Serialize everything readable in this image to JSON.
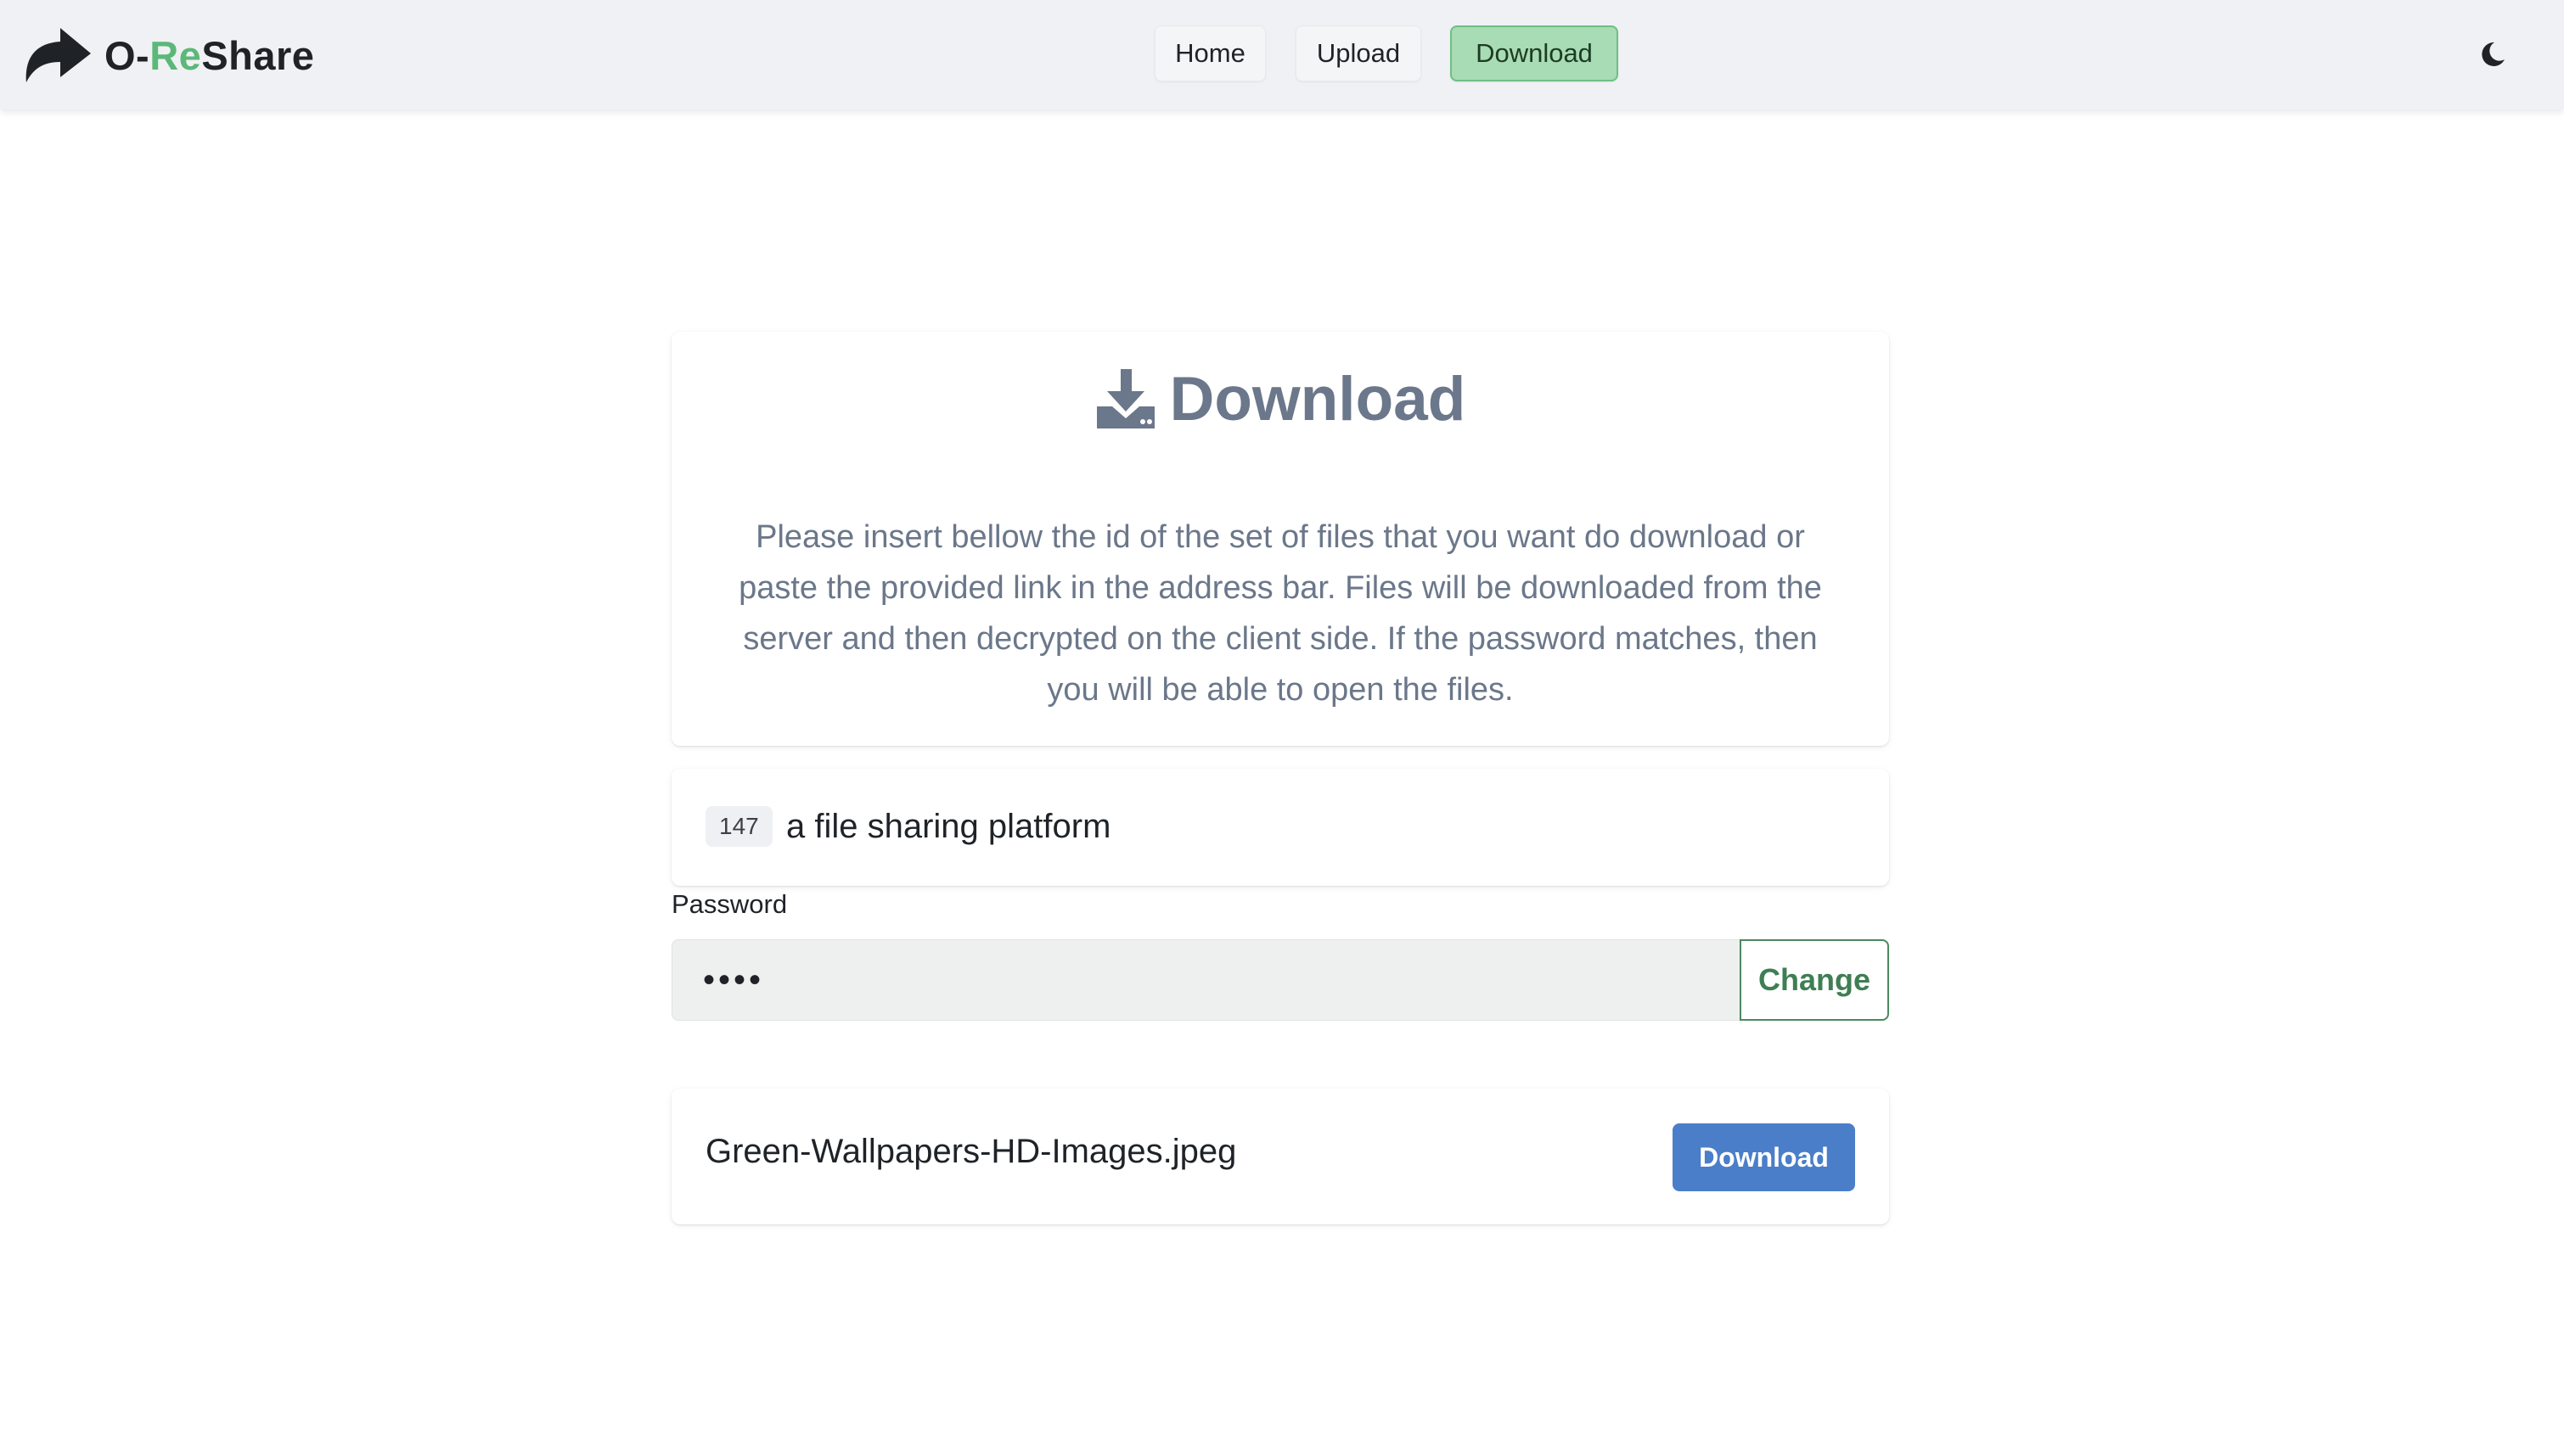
{
  "navbar": {
    "brand": {
      "prefix": "O-",
      "accent": "Re",
      "suffix": "Share",
      "logo_icon": "share-arrow-icon"
    },
    "links": [
      {
        "label": "Home",
        "active": false
      },
      {
        "label": "Upload",
        "active": false
      },
      {
        "label": "Download",
        "active": true
      }
    ],
    "theme_toggle_icon": "moon-icon"
  },
  "header_card": {
    "icon": "download-tray-icon",
    "title": "Download",
    "description": "Please insert bellow the id of the set of files that you want do download or paste the provided link in the address bar. Files will be downloaded from the server and then decrypted on the client side. If the password matches, then you will be able to open the files."
  },
  "id_card": {
    "badge": "147",
    "text": "a file sharing platform"
  },
  "password": {
    "label": "Password",
    "value": "••••",
    "button_label": "Change"
  },
  "file": {
    "name": "Green-Wallpapers-HD-Images.jpeg",
    "button_label": "Download"
  },
  "colors": {
    "brand_accent": "#5cb879",
    "active_nav_bg": "#a8dcb4",
    "muted_text": "#6b778a",
    "change_button": "#3f7e53",
    "download_button": "#4a7ec8"
  }
}
